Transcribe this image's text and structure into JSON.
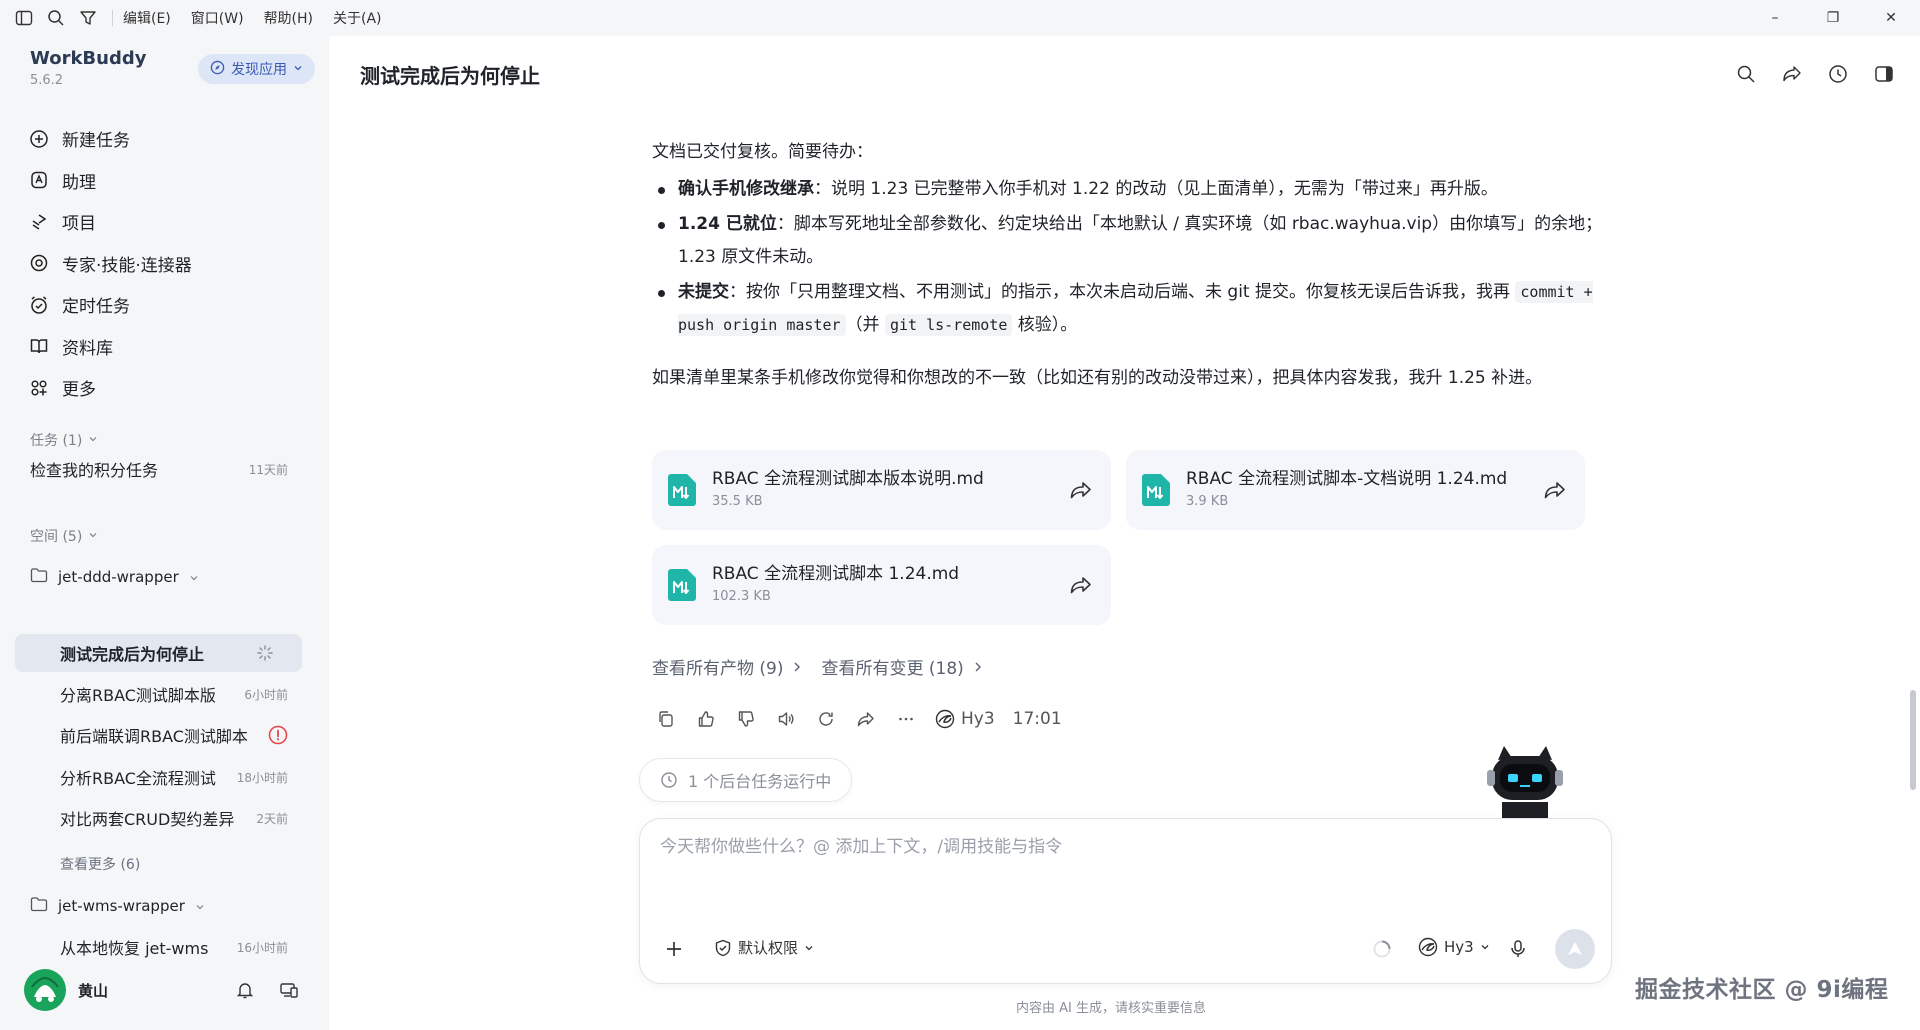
{
  "menu": [
    "编辑(E)",
    "窗口(W)",
    "帮助(H)",
    "关于(A)"
  ],
  "window_controls": {
    "minimize": "–",
    "restore": "❐",
    "close": "✕"
  },
  "app": {
    "name": "WorkBuddy",
    "version": "5.6.2",
    "discover_label": "发现应用"
  },
  "nav": [
    {
      "label": "新建任务",
      "icon": "plus-circle-icon"
    },
    {
      "label": "助理",
      "icon": "assistant-icon"
    },
    {
      "label": "项目",
      "icon": "project-icon"
    },
    {
      "label": "专家·技能·连接器",
      "icon": "expert-icon"
    },
    {
      "label": "定时任务",
      "icon": "alarm-icon"
    },
    {
      "label": "资料库",
      "icon": "book-icon"
    },
    {
      "label": "更多",
      "icon": "grid-icon"
    }
  ],
  "tasks_section": {
    "header": "任务 (1)",
    "items": [
      {
        "label": "检查我的积分任务",
        "time": "11天前"
      }
    ]
  },
  "spaces_section": {
    "header": "空间 (5)",
    "folder1": {
      "name": "jet-ddd-wrapper"
    },
    "items": [
      {
        "label": "测试完成后为何停止",
        "time": ""
      },
      {
        "label": "分离RBAC测试脚本版",
        "time": "6小时前"
      },
      {
        "label": "前后端联调RBAC测试脚本",
        "time": ""
      },
      {
        "label": "分析RBAC全流程测试",
        "time": "18小时前"
      },
      {
        "label": "对比两套CRUD契约差异",
        "time": "2天前"
      }
    ],
    "see_more": "查看更多 (6)",
    "folder2": {
      "name": "jet-wms-wrapper"
    },
    "folder2_items": [
      {
        "label": "从本地恢复 jet-wms",
        "time": "16小时前"
      }
    ]
  },
  "user": {
    "name": "黄山"
  },
  "main": {
    "title": "测试完成后为何停止",
    "intro": "文档已交付复核。简要待办：",
    "bullets": [
      {
        "bold": "确认手机修改继承",
        "text": "：说明 1.23 已完整带入你手机对 1.22 的改动（见上面清单），无需为「带过来」再升版。"
      },
      {
        "bold": "1.24 已就位",
        "text": "：脚本写死地址全部参数化、约定块给出「本地默认 / 真实环境（如 rbac.wayhua.vip）由你填写」的余地；1.23 原文件未动。"
      }
    ],
    "bullet3": {
      "bold": "未提交",
      "text_a": "：按你「只用整理文档、不用测试」的指示，本次未启动后端、未 git 提交。你复核无误后告诉我，我再 ",
      "code_a": "commit + push origin master",
      "text_b": "（并 ",
      "code_b": "git ls-remote",
      "text_c": " 核验）。"
    },
    "para2": "如果清单里某条手机修改你觉得和你想改的不一致（比如还有别的改动没带过来），把具体内容发我，我升 1.25 补进。",
    "files": [
      {
        "name": "RBAC 全流程测试脚本版本说明.md",
        "size": "35.5 KB"
      },
      {
        "name": "RBAC 全流程测试脚本-文档说明 1.24.md",
        "size": "3.9 KB"
      },
      {
        "name": "RBAC 全流程测试脚本 1.24.md",
        "size": "102.3 KB"
      }
    ],
    "link_artifacts": "查看所有产物 (9)",
    "link_changes": "查看所有变更 (18)",
    "model_label": "Hy3",
    "msg_time": "17:01",
    "bg_task": "1 个后台任务运行中"
  },
  "composer": {
    "placeholder": "今天帮你做些什么？@ 添加上下文，/调用技能与指令",
    "permission": "默认权限",
    "model": "Hy3"
  },
  "disclaimer": "内容由 AI 生成，请核实重要信息",
  "watermark": "掘金技术社区 @ 9i编程",
  "colors": {
    "accent": "#3a5bb3",
    "sidebar_bg": "#f5f6f8",
    "file_icon": "#1fb5a8",
    "error": "#e5484d"
  }
}
